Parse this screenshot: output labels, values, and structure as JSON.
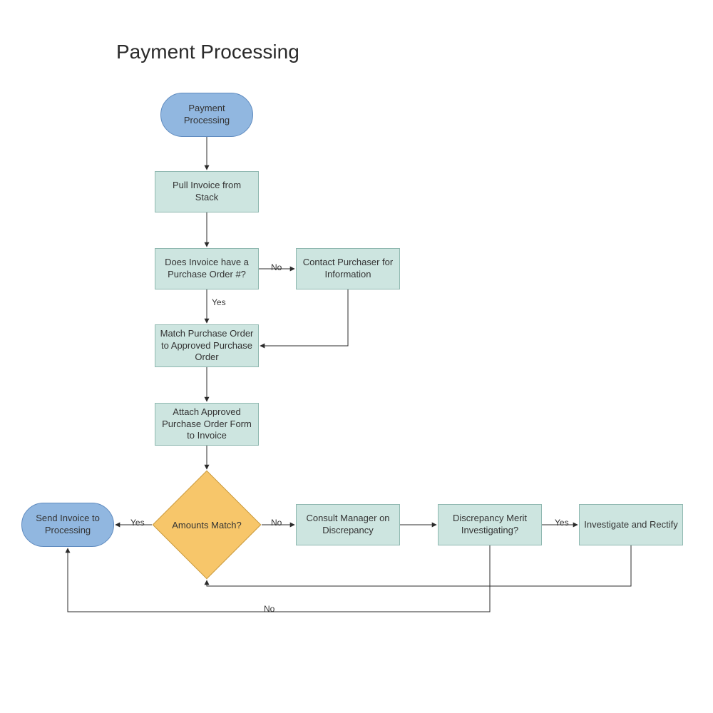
{
  "title": "Payment Processing",
  "nodes": {
    "start": "Payment\nProcessing",
    "pull": "Pull  Invoice from Stack",
    "hasPO": "Does Invoice have a Purchase Order #?",
    "contact": "Contact Purchaser for Information",
    "match": "Match  Purchase Order to Approved Purchase Order",
    "attach": "Attach Approved Purchase Order Form to Invoice",
    "amounts": "Amounts Match?",
    "send": "Send Invoice to Processing",
    "consult": "Consult Manager on Discrepancy",
    "merit": "Discrepancy Merit Investigating?",
    "investigate": "Investigate and Rectify"
  },
  "labels": {
    "yes": "Yes",
    "no": "No"
  }
}
